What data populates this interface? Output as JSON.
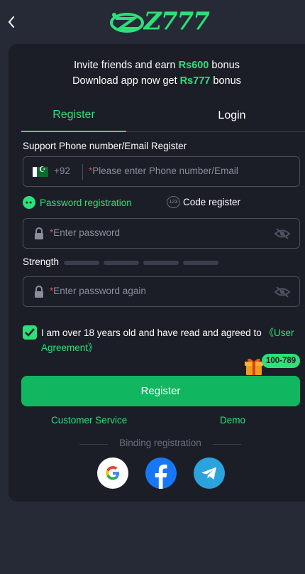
{
  "header": {
    "back_icon": "chevron-left-icon",
    "logo_text": "Z777"
  },
  "invite": {
    "line1_prefix": "Invite friends and earn ",
    "line1_amount": "Rs600",
    "line1_suffix": " bonus",
    "line2_prefix": "Download app now get ",
    "line2_amount": "Rs777",
    "line2_suffix": " bonus"
  },
  "tabs": {
    "register": "Register",
    "login": "Login",
    "active": "register"
  },
  "form": {
    "support_label": "Support Phone number/Email Register",
    "country_code": "+92",
    "phone_placeholder": "Please enter Phone number/Email",
    "required_mark": "*",
    "option_password": "Password registration",
    "option_code": "Code register",
    "password_placeholder": "Enter password",
    "strength_label": "Strength",
    "password_again_placeholder": "Enter password again",
    "agree_text": "I am over 18 years old and have read and agreed to ",
    "agree_link": "《User Agreement》",
    "agree_checked": true
  },
  "promo_badge": "100-789",
  "register_button": "Register",
  "links": {
    "customer_service": "Customer Service",
    "demo": "Demo"
  },
  "binding_label": "Binding registration",
  "social": [
    "google-icon",
    "facebook-icon",
    "telegram-icon"
  ],
  "colors": {
    "accent": "#2ee07a",
    "button": "#11b760",
    "background": "#262a37",
    "card": "#1b1e27"
  }
}
